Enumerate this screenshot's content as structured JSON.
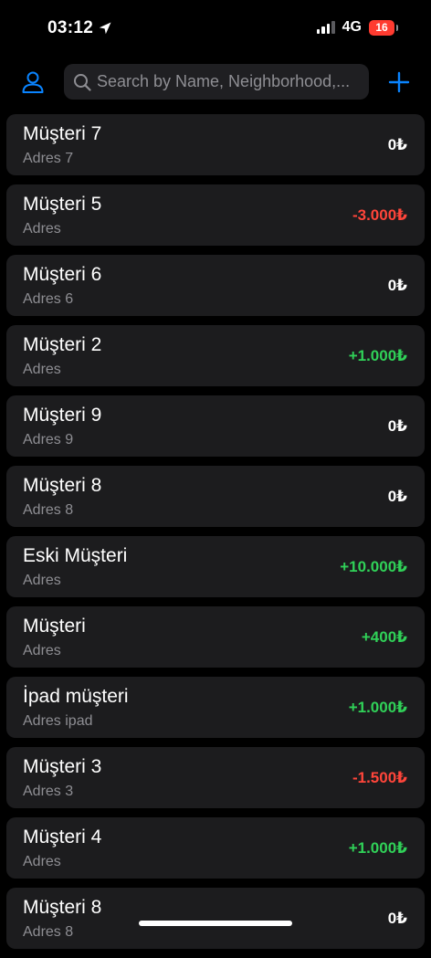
{
  "status_bar": {
    "time": "03:12",
    "network": "4G",
    "battery": "16"
  },
  "header": {
    "search_placeholder": "Search by Name, Neighborhood,..."
  },
  "colors": {
    "accent": "#0a84ff",
    "positive": "#30d158",
    "negative": "#ff453a",
    "battery_low": "#ff3b30"
  },
  "customers": [
    {
      "name": "Müşteri 7",
      "address": "Adres 7",
      "balance": "0₺",
      "sign": "zero"
    },
    {
      "name": "Müşteri 5",
      "address": "Adres",
      "balance": "-3.000₺",
      "sign": "neg"
    },
    {
      "name": "Müşteri 6",
      "address": "Adres 6",
      "balance": "0₺",
      "sign": "zero"
    },
    {
      "name": "Müşteri 2",
      "address": "Adres",
      "balance": "+1.000₺",
      "sign": "pos"
    },
    {
      "name": "Müşteri 9",
      "address": "Adres 9",
      "balance": "0₺",
      "sign": "zero"
    },
    {
      "name": "Müşteri 8",
      "address": "Adres 8",
      "balance": "0₺",
      "sign": "zero"
    },
    {
      "name": "Eski Müşteri",
      "address": "Adres",
      "balance": "+10.000₺",
      "sign": "pos"
    },
    {
      "name": "Müşteri",
      "address": "Adres",
      "balance": "+400₺",
      "sign": "pos"
    },
    {
      "name": "İpad müşteri",
      "address": "Adres ipad",
      "balance": "+1.000₺",
      "sign": "pos"
    },
    {
      "name": "Müşteri 3",
      "address": "Adres 3",
      "balance": "-1.500₺",
      "sign": "neg"
    },
    {
      "name": "Müşteri 4",
      "address": "Adres",
      "balance": "+1.000₺",
      "sign": "pos"
    },
    {
      "name": "Müşteri 8",
      "address": "Adres 8",
      "balance": "0₺",
      "sign": "zero"
    }
  ]
}
